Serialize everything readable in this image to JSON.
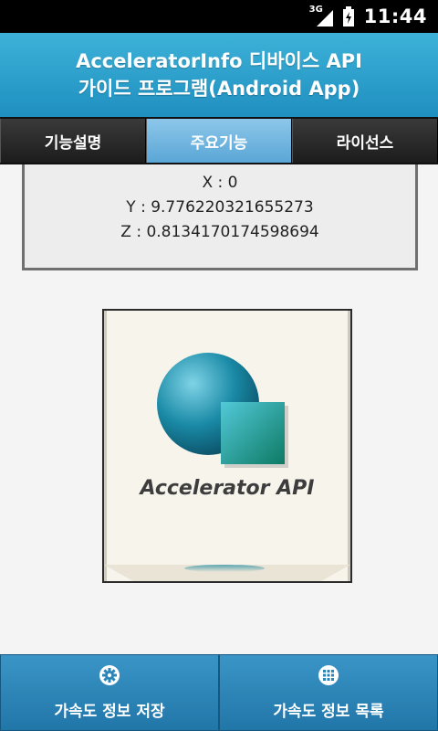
{
  "status": {
    "network": "3G",
    "time": "11:44"
  },
  "header": {
    "line1": "AcceleratorInfo 디바이스 API",
    "line2": "가이드 프로그램(Android App)"
  },
  "tabs": [
    {
      "label": "기능설명",
      "active": false
    },
    {
      "label": "주요기능",
      "active": true
    },
    {
      "label": "라이선스",
      "active": false
    }
  ],
  "accelerometer": {
    "x": "X : 0",
    "y": "Y : 9.776220321655273",
    "z": "Z : 0.8134170174598694"
  },
  "image": {
    "label": "Accelerator API",
    "reflection": "Accelerator API"
  },
  "colors": {
    "header": "#2ba3d0",
    "active_tab": "#6fb5e0",
    "bottom_bar": "#2a86b8"
  },
  "bottom": {
    "save": {
      "label": "가속도 정보 저장",
      "icon": "gear-icon"
    },
    "list": {
      "label": "가속도 정보 목록",
      "icon": "grid-icon"
    }
  }
}
